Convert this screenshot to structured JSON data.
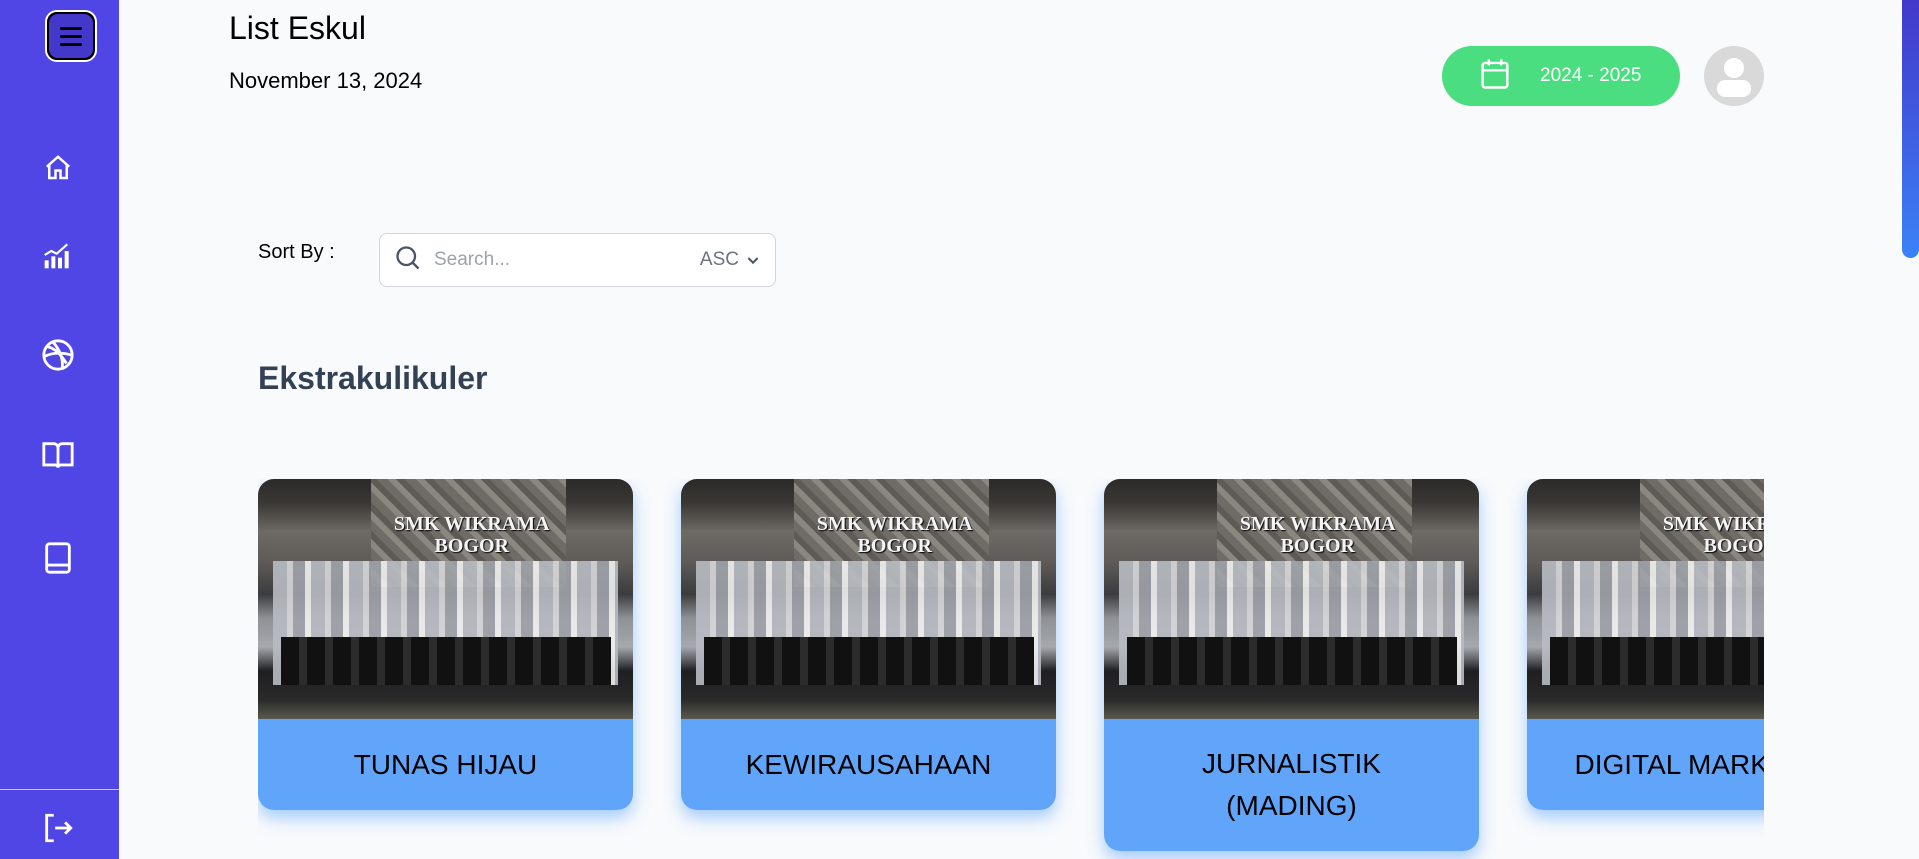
{
  "header": {
    "title": "List Eskul",
    "date": "November 13, 2024",
    "school_year": "2024 - 2025"
  },
  "sidebar": {
    "items": [
      {
        "icon": "home-icon"
      },
      {
        "icon": "chart-icon"
      },
      {
        "icon": "basketball-icon"
      },
      {
        "icon": "open-book-icon"
      },
      {
        "icon": "book-icon"
      }
    ],
    "logout_icon": "logout-icon"
  },
  "filter": {
    "sort_label": "Sort By :",
    "search_placeholder": "Search...",
    "sort_value": "ASC"
  },
  "section": {
    "heading": "Ekstrakulikuler"
  },
  "cards": [
    {
      "name": "TUNAS HIJAU",
      "sign_line1": "SMK WIKRAMA",
      "sign_line2": "BOGOR"
    },
    {
      "name": "KEWIRAUSAHAAN",
      "sign_line1": "SMK WIKRAMA",
      "sign_line2": "BOGOR"
    },
    {
      "name": "JURNALISTIK\n(MADING)",
      "sign_line1": "SMK WIKRAMA",
      "sign_line2": "BOGOR"
    },
    {
      "name": "DIGITAL MARKETING",
      "sign_line1": "SMK WIKRAMA",
      "sign_line2": "BOGOR"
    }
  ],
  "colors": {
    "sidebar": "#4f46e5",
    "pill": "#4ade80",
    "card_label": "#60a5fa"
  }
}
